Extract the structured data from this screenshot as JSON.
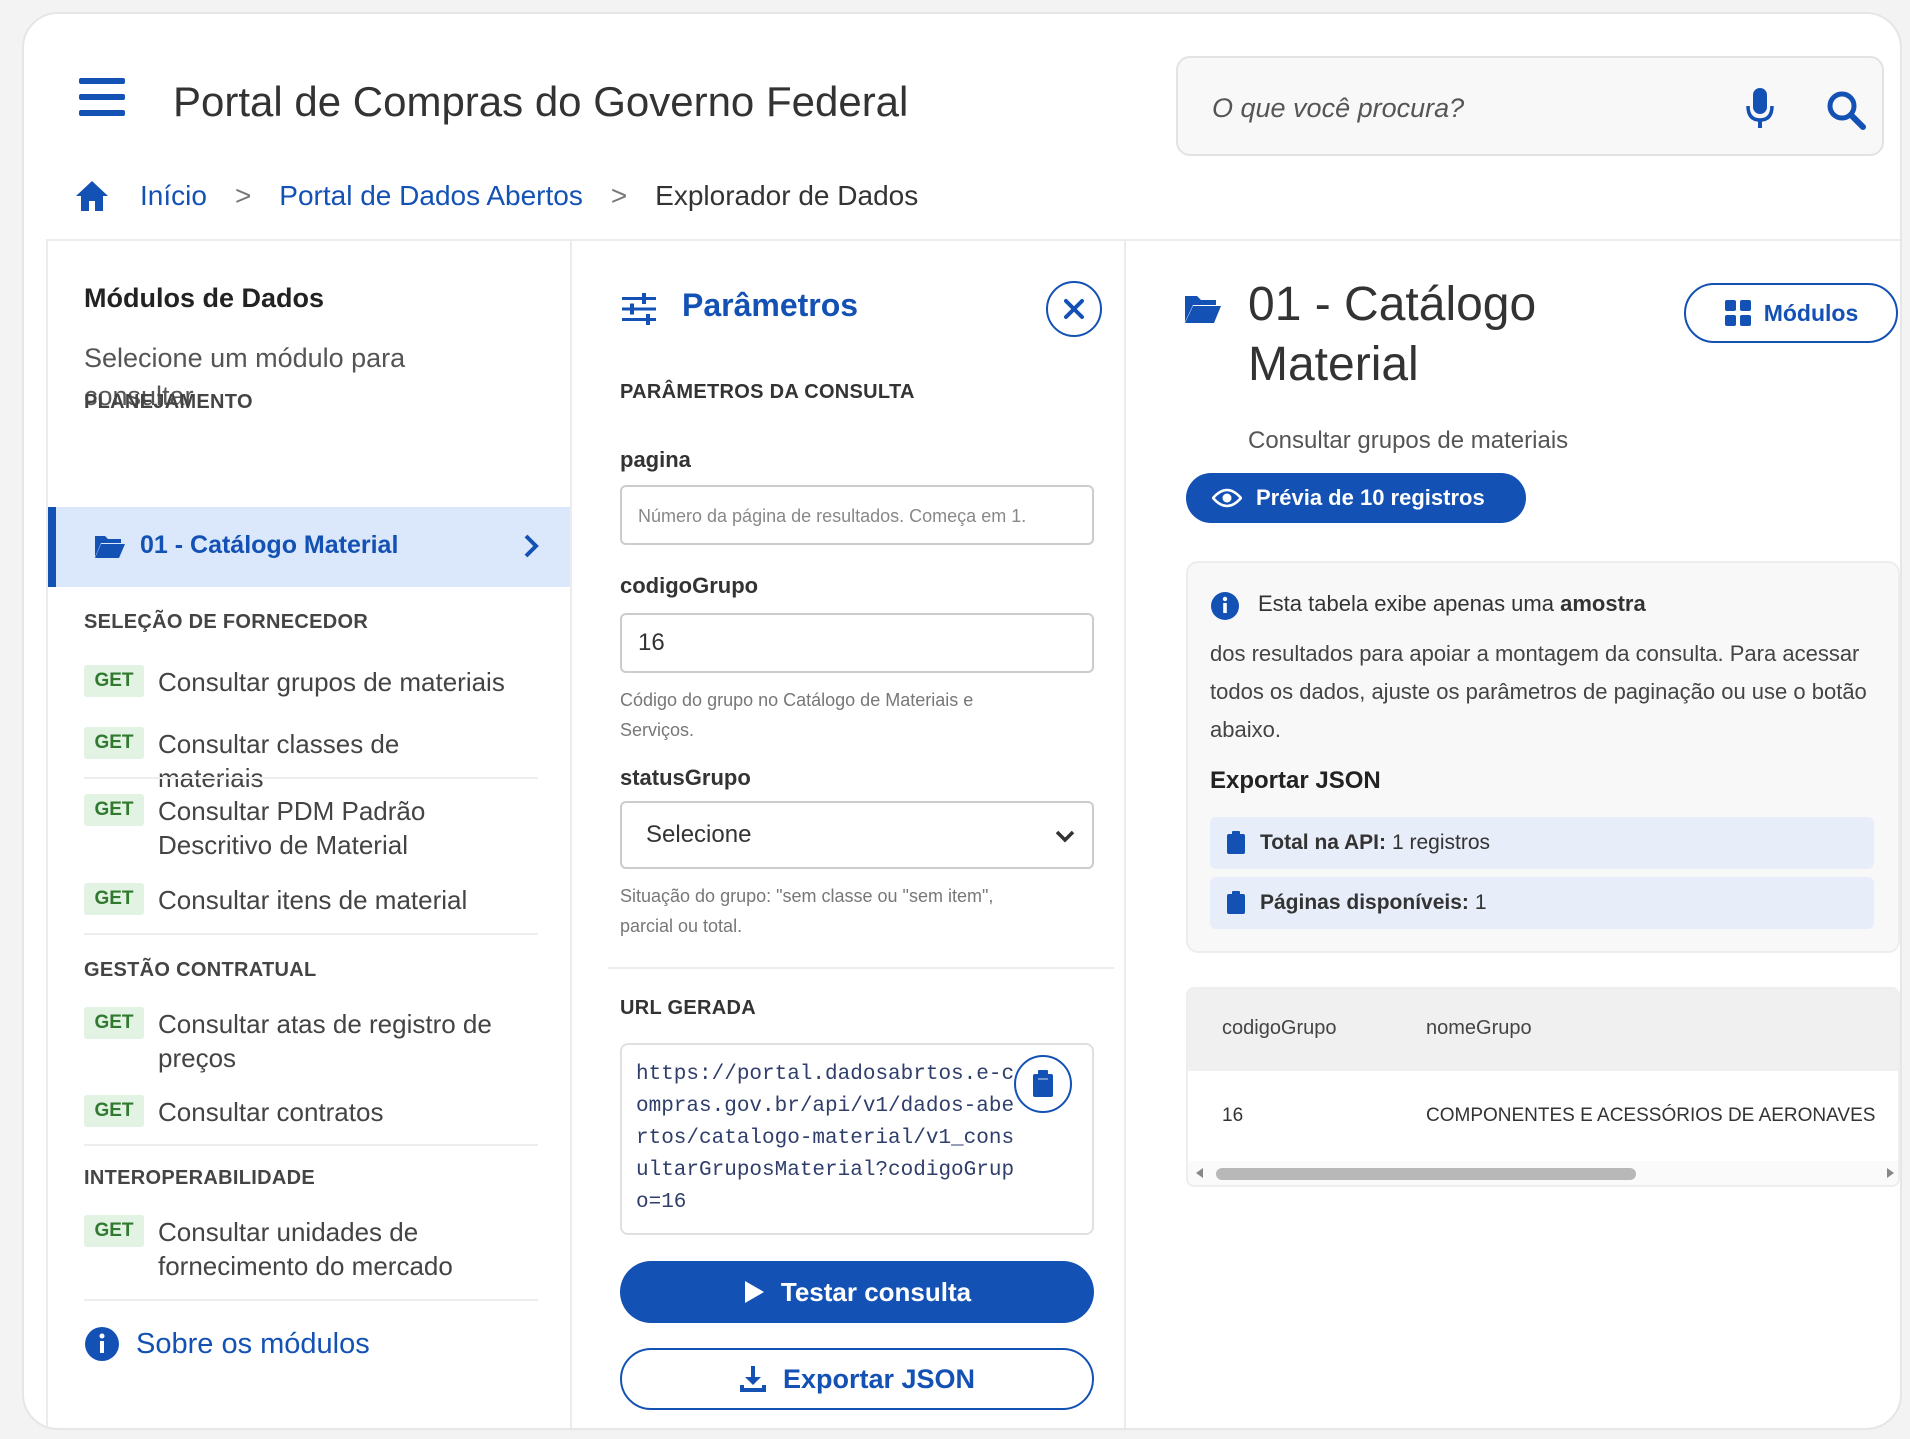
{
  "header": {
    "title": "Portal de Compras do Governo Federal",
    "search_placeholder": "O que você procura?"
  },
  "breadcrumb": {
    "items": [
      "Início",
      "Portal de Dados Abertos"
    ],
    "current": "Explorador de Dados",
    "separator": ">"
  },
  "sidebar": {
    "title": "Módulos de Dados",
    "subtitle": "Selecione um módulo para consultar",
    "sections": [
      {
        "label": "PLANEJAMENTO"
      },
      {
        "label": "SELEÇÃO DE FORNECEDOR"
      },
      {
        "label": "GESTÃO CONTRATUAL"
      },
      {
        "label": "INTEROPERABILIDADE"
      }
    ],
    "active_item": "01 - Catálogo Material",
    "method_badge": "GET",
    "items": [
      {
        "label": "Consultar grupos de materiais"
      },
      {
        "label": "Consultar classes de materiais"
      },
      {
        "label": "Consultar PDM Padrão Descritivo de Material"
      },
      {
        "label": "Consultar itens de material"
      },
      {
        "label": "Consultar atas de registro de preços"
      },
      {
        "label": "Consultar contratos"
      },
      {
        "label": "Consultar unidades de fornecimento do mercado"
      }
    ],
    "about_label": "Sobre os módulos"
  },
  "params": {
    "title": "Parâmetros",
    "section_label": "PARÂMETROS DA CONSULTA",
    "fields": {
      "pagina": {
        "label": "pagina",
        "placeholder": "Número da página de resultados. Começa em 1.",
        "value": ""
      },
      "codigoGrupo": {
        "label": "codigoGrupo",
        "value": "16",
        "hint": "Código do grupo no Catálogo de Materiais e Serviços."
      },
      "statusGrupo": {
        "label": "statusGrupo",
        "selected": "Selecione",
        "hint": "Situação do grupo: \"sem classe ou \"sem item\", parcial ou total."
      }
    },
    "url_label": "URL GERADA",
    "url": "https://portal.dadosabrtos.e-compras.gov.br/api/v1/dados-abertos/catalogo-material/v1_consultarGruposMaterial?codigoGrupo=16",
    "test_button": "Testar consulta",
    "export_button": "Exportar JSON"
  },
  "detail": {
    "title": "01 - Catálogo Material",
    "modules_button": "Módulos",
    "subtitle": "Consultar grupos de materiais",
    "preview_button": "Prévia de 10 registros",
    "info_intro": "Esta tabela exibe apenas uma",
    "info_bold": "amostra",
    "info_text": "dos resultados para apoiar a montagem da consulta. Para acessar todos os dados, ajuste os parâmetros de paginação ou use o botão abaixo.",
    "export_title": "Exportar JSON",
    "total_label": "Total na API:",
    "total_value": "1 registros",
    "pages_label": "Páginas disponíveis:",
    "pages_value": "1",
    "table": {
      "columns": [
        "codigoGrupo",
        "nomeGrupo"
      ],
      "rows": [
        [
          "16",
          "COMPONENTES E ACESSÓRIOS DE AERONAVES"
        ]
      ]
    }
  },
  "colors": {
    "primary": "#1351b4",
    "active_bg": "#dbe8fb",
    "get_badge_bg": "#e3f3e3",
    "get_badge_text": "#2f7a2f"
  }
}
